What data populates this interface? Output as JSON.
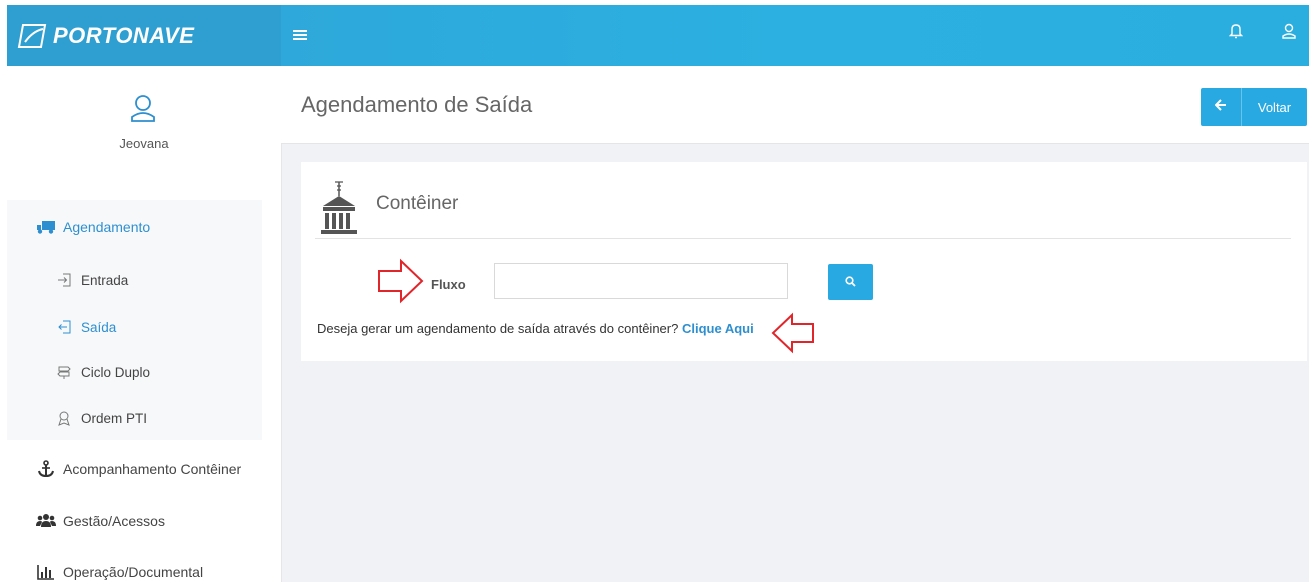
{
  "brand": {
    "name": "PORTONAVE"
  },
  "header": {
    "menu_icon": "hamburger-icon",
    "notification_icon": "bell-icon",
    "user_icon": "user-icon"
  },
  "sidebar": {
    "username": "Jeovana",
    "items": [
      {
        "label": "Agendamento",
        "icon": "truck-icon",
        "active": true
      },
      {
        "label": "Entrada",
        "icon": "sign-in-icon"
      },
      {
        "label": "Saída",
        "icon": "sign-out-icon",
        "active": true
      },
      {
        "label": "Ciclo Duplo",
        "icon": "signpost-icon"
      },
      {
        "label": "Ordem PTI",
        "icon": "badge-icon"
      },
      {
        "label": "Acompanhamento Contêiner",
        "icon": "anchor-icon"
      },
      {
        "label": "Gestão/Acessos",
        "icon": "users-icon"
      },
      {
        "label": "Operação/Documental",
        "icon": "bar-chart-icon"
      }
    ]
  },
  "page": {
    "title": "Agendamento de Saída",
    "back_label": "Voltar"
  },
  "panel": {
    "title": "Contêiner",
    "fluxo_label": "Fluxo",
    "fluxo_value": "",
    "hint_text": "Deseja gerar um agendamento de saída através do contêiner?",
    "hint_link": "Clique Aqui"
  },
  "colors": {
    "accent": "#29a9e2",
    "header": "#2fa4d6",
    "annotation": "#e0262b"
  }
}
